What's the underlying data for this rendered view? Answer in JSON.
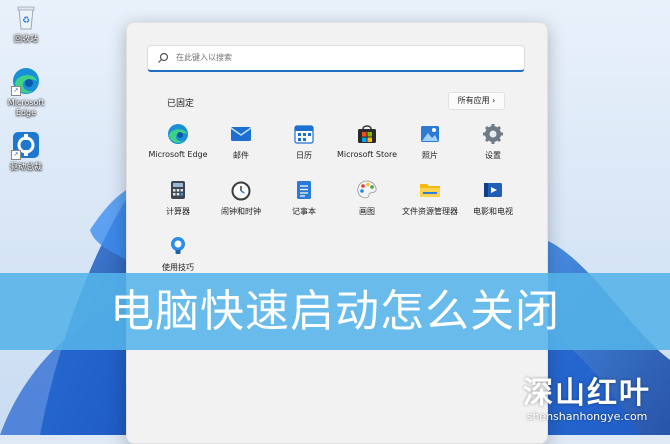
{
  "desktop": {
    "icons": [
      {
        "label": "回收站",
        "icon": "recycle-bin-icon"
      },
      {
        "label": "Microsoft Edge",
        "icon": "edge-icon"
      },
      {
        "label": "驱动总裁",
        "icon": "driver-tool-icon"
      }
    ]
  },
  "start_menu": {
    "search_placeholder": "在此键入以搜索",
    "pinned_title": "已固定",
    "all_apps_label": "所有应用",
    "all_apps_chevron": "›",
    "pinned_apps": [
      {
        "label": "Microsoft Edge",
        "icon": "edge-icon"
      },
      {
        "label": "邮件",
        "icon": "mail-icon"
      },
      {
        "label": "日历",
        "icon": "calendar-icon"
      },
      {
        "label": "Microsoft Store",
        "icon": "store-icon"
      },
      {
        "label": "照片",
        "icon": "photos-icon"
      },
      {
        "label": "设置",
        "icon": "settings-gear-icon"
      },
      {
        "label": "计算器",
        "icon": "calculator-icon"
      },
      {
        "label": "闹钟和时钟",
        "icon": "alarm-clock-icon"
      },
      {
        "label": "记事本",
        "icon": "notepad-icon"
      },
      {
        "label": "画图",
        "icon": "paint-icon"
      },
      {
        "label": "文件资源管理器",
        "icon": "file-explorer-icon"
      },
      {
        "label": "电影和电视",
        "icon": "movies-tv-icon"
      },
      {
        "label": "使用技巧",
        "icon": "tips-icon"
      }
    ]
  },
  "banner": {
    "title": "电脑快速启动怎么关闭"
  },
  "watermark": {
    "name": "深山红叶",
    "url": "shenshanhongye.com"
  },
  "colors": {
    "banner": "#54b3e8",
    "accent": "#1f6fbf",
    "menu_bg": "#f2f2f2"
  }
}
